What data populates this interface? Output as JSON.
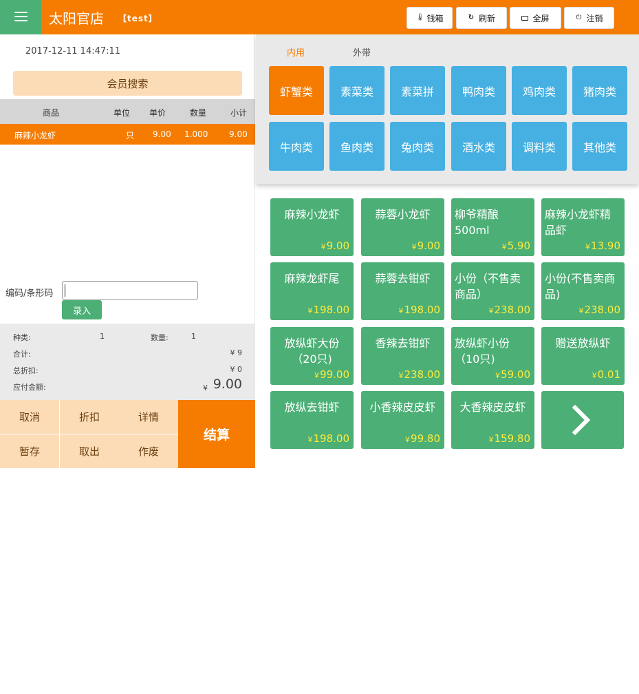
{
  "header": {
    "store_name": "太阳官店",
    "store_tag": "【test】",
    "buttons": [
      {
        "label": "钱箱",
        "icon": "thermometer-icon"
      },
      {
        "label": "刷新",
        "icon": "refresh-icon"
      },
      {
        "label": "全屏",
        "icon": "monitor-icon"
      },
      {
        "label": "注销",
        "icon": "power-icon"
      }
    ]
  },
  "order": {
    "datetime": "2017-12-11 14:47:11",
    "member_search": "会员搜索",
    "columns": {
      "name": "商品",
      "unit": "单位",
      "price": "单价",
      "qty": "数量",
      "subtotal": "小计"
    },
    "items": [
      {
        "name": "麻辣小龙虾",
        "unit": "只",
        "price": "9.00",
        "qty": "1.000",
        "subtotal": "9.00"
      }
    ],
    "code_label": "编码/条形码",
    "code_value": "",
    "enter_label": "录入",
    "summary": {
      "kinds_label": "种类:",
      "kinds_value": "1",
      "qty_label": "数量:",
      "qty_value": "1",
      "total_label": "合计:",
      "total_value": "¥  9",
      "discount_label": "总折扣:",
      "discount_value": "¥  0",
      "payable_label": "应付金额:",
      "payable_currency": "¥",
      "payable_value": "9.00"
    },
    "actions": [
      "取消",
      "折扣",
      "详情",
      "暂存",
      "取出",
      "作废"
    ],
    "settle_label": "结算"
  },
  "menu": {
    "tabs": [
      {
        "label": "内用",
        "active": true
      },
      {
        "label": "外带",
        "active": false
      }
    ],
    "categories": [
      "虾蟹类",
      "素菜类",
      "素菜拼",
      "鸭肉类",
      "鸡肉类",
      "猪肉类",
      "牛肉类",
      "鱼肉类",
      "兔肉类",
      "酒水类",
      "调料类",
      "其他类"
    ],
    "active_category": "虾蟹类",
    "currency": "¥",
    "products": [
      {
        "name": "麻辣小龙虾",
        "price": "9.00"
      },
      {
        "name": "蒜蓉小龙虾",
        "price": "9.00"
      },
      {
        "name": "柳爷精酿500ml",
        "price": "5.90"
      },
      {
        "name": "麻辣小龙虾精品虾",
        "price": "13.90"
      },
      {
        "name": "麻辣龙虾尾",
        "price": "198.00"
      },
      {
        "name": "蒜蓉去钳虾",
        "price": "198.00"
      },
      {
        "name": "小份（不售卖商品）",
        "price": "238.00"
      },
      {
        "name": "小份(不售卖商品)",
        "price": "238.00"
      },
      {
        "name": "放纵虾大份（20只)",
        "price": "99.00"
      },
      {
        "name": "香辣去钳虾",
        "price": "238.00"
      },
      {
        "name": "放纵虾小份（10只)",
        "price": "59.00"
      },
      {
        "name": "赠送放纵虾",
        "price": "0.01"
      },
      {
        "name": "放纵去钳虾",
        "price": "198.00"
      },
      {
        "name": "小香辣皮皮虾",
        "price": "99.80"
      },
      {
        "name": "大香辣皮皮虾",
        "price": "159.80"
      }
    ],
    "next_icon": "chevron-right-icon"
  },
  "colors": {
    "orange": "#f57c00",
    "green": "#4caf76",
    "blue": "#45b0e1",
    "peach": "#fcdcb6",
    "price_yellow": "#ffeb3b"
  }
}
